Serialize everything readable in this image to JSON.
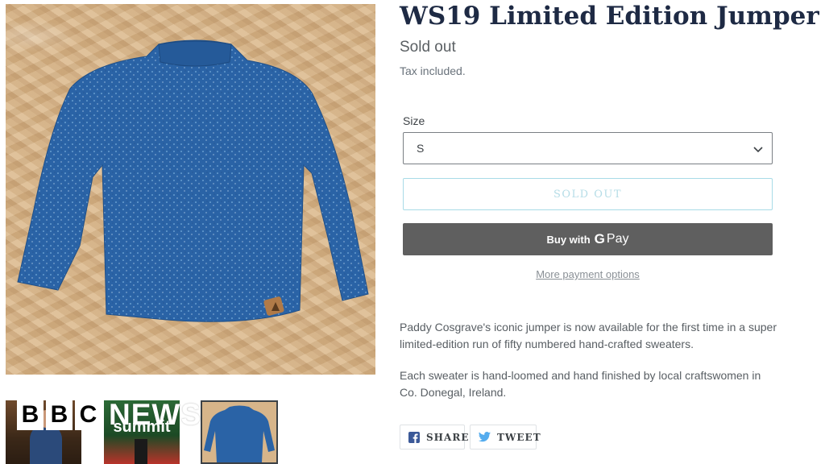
{
  "product": {
    "title": "WS19 Limited Edition Jumper",
    "status": "Sold out",
    "tax_note": "Tax included."
  },
  "variant": {
    "size_label": "Size",
    "selected_size": "S"
  },
  "buttons": {
    "sold_out": "SOLD OUT",
    "gpay_prefix": "Buy with",
    "gpay_g": "G",
    "gpay_word": "Pay",
    "more_payment": "More payment options"
  },
  "description": [
    "Paddy Cosgrave's iconic jumper is now available for the first time in a super limited-edition run of fifty numbered hand-crafted sweaters.",
    "Each sweater is hand-loomed and hand finished by local craftswomen in Co. Donegal, Ireland."
  ],
  "social": {
    "share_label": "SHARE",
    "tweet_label": "TWEET"
  },
  "thumbnails": {
    "summit_text": "summit"
  },
  "watermark": {
    "letters": [
      "B",
      "B",
      "C"
    ],
    "news": "NEWS"
  },
  "colors": {
    "title": "#1e2a44",
    "gpay_bg": "#5f5f5f",
    "sold_out_border": "#a8dbe7",
    "sweater": "#2a63a6"
  }
}
